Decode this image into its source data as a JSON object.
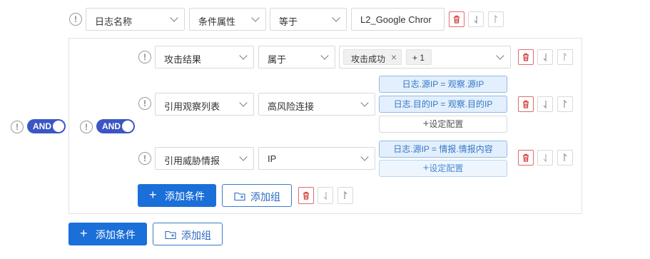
{
  "top_row": {
    "field": "日志名称",
    "attr": "条件属性",
    "op": "等于",
    "value": "L2_Google Chror"
  },
  "outer_toggle": "AND",
  "inner_toggle": "AND",
  "row1": {
    "field": "攻击结果",
    "op": "属于",
    "tag1": "攻击成功",
    "tag1_close": "×",
    "tag_more": "+ 1"
  },
  "row2": {
    "field": "引用观察列表",
    "value": "高风险连接",
    "cfg1": "日志.源IP = 观察.源IP",
    "cfg2": "日志.目的IP = 观察.目的IP",
    "cfg_add": "设定配置"
  },
  "row3": {
    "field": "引用威胁情报",
    "value": "IP",
    "cfg1": "日志.源IP = 情报.情报内容",
    "cfg_add": "设定配置"
  },
  "inner_actions": {
    "add_condition": "添加条件",
    "add_group": "添加组"
  },
  "outer_actions": {
    "add_condition": "添加条件",
    "add_group": "添加组"
  },
  "icons": {
    "info": "!",
    "plus": "+"
  },
  "colors": {
    "primary": "#1a6fd8",
    "toggle": "#3b56c4",
    "delete": "#d23b3b",
    "config_text": "#3478c6"
  }
}
